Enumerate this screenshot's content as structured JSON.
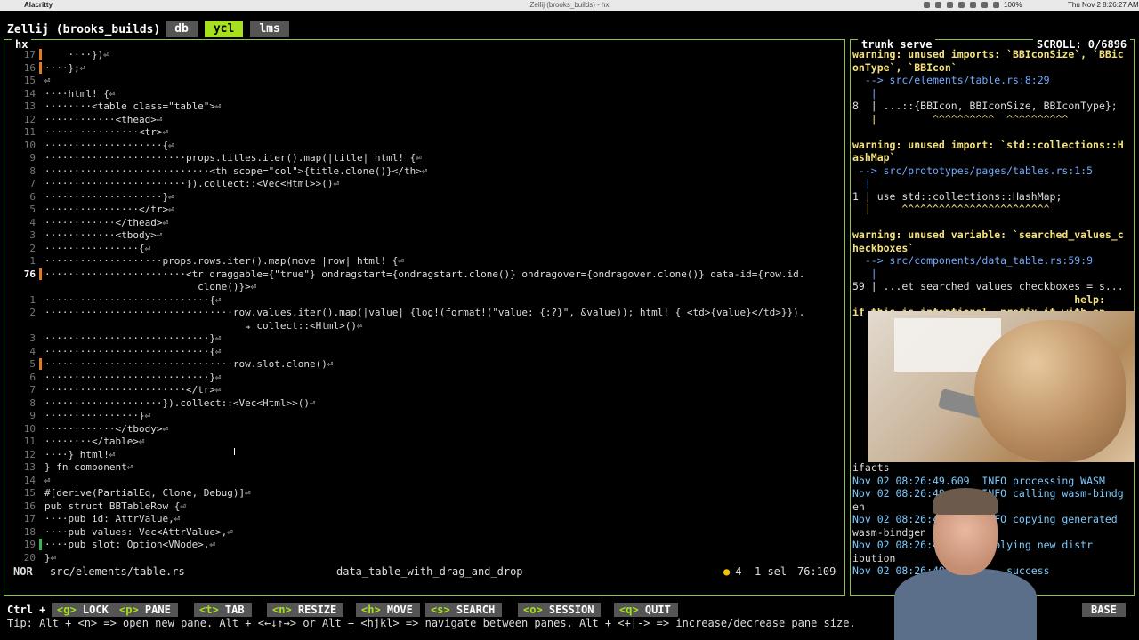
{
  "menubar": {
    "app": "Alacritty",
    "window_title": "Zellij (brooks_builds) - hx",
    "battery": "100%",
    "clock": "Thu Nov 2  8:26:27 AM"
  },
  "zellij": {
    "session": "Zellij (brooks_builds)",
    "tabs": [
      {
        "label": "db",
        "active": false
      },
      {
        "label": "ycl",
        "active": true
      },
      {
        "label": "lms",
        "active": false
      }
    ]
  },
  "left_pane": {
    "title": "hx"
  },
  "editor": {
    "lines": [
      {
        "n": "17",
        "code": "    ····})⏎"
      },
      {
        "n": "16",
        "code": "····};⏎"
      },
      {
        "n": "15",
        "code": "⏎"
      },
      {
        "n": "14",
        "code": "····html! {⏎"
      },
      {
        "n": "13",
        "code": "········<table class=\"table\">⏎"
      },
      {
        "n": "12",
        "code": "············<thead>⏎"
      },
      {
        "n": "11",
        "code": "················<tr>⏎"
      },
      {
        "n": "10",
        "code": "····················{⏎"
      },
      {
        "n": "9",
        "code": "························props.titles.iter().map(|title| html! {⏎"
      },
      {
        "n": "8",
        "code": "····························<th scope=\"col\">{title.clone()}</th>⏎"
      },
      {
        "n": "7",
        "code": "························}).collect::<Vec<Html>>()⏎"
      },
      {
        "n": "6",
        "code": "····················}⏎"
      },
      {
        "n": "5",
        "code": "················</tr>⏎"
      },
      {
        "n": "4",
        "code": "············</thead>⏎"
      },
      {
        "n": "3",
        "code": "············<tbody>⏎"
      },
      {
        "n": "2",
        "code": "················{⏎"
      },
      {
        "n": "1",
        "code": "····················props.rows.iter().map(move |row| html! {⏎"
      },
      {
        "n": "76",
        "code": "························<tr draggable={\"true\"} ondragstart={ondragstart.clone()} ondragover={ondragover.clone()} data-id={row.id.",
        "cur": true
      },
      {
        "n": "",
        "code": "                          clone()}>⏎"
      },
      {
        "n": "1",
        "code": "····························{⏎"
      },
      {
        "n": "2",
        "code": "································row.values.iter().map(|value| {log!(format!(\"value: {:?}\", &value)); html! { <td>{value}</td>}})."
      },
      {
        "n": "",
        "code": "                                  ↳ collect::<Html>()⏎"
      },
      {
        "n": "3",
        "code": "····························}⏎"
      },
      {
        "n": "4",
        "code": "····························{⏎"
      },
      {
        "n": "5",
        "code": "································row.slot.clone()⏎"
      },
      {
        "n": "6",
        "code": "····························}⏎"
      },
      {
        "n": "7",
        "code": "························</tr>⏎"
      },
      {
        "n": "8",
        "code": "····················}).collect::<Vec<Html>>()⏎"
      },
      {
        "n": "9",
        "code": "················}⏎"
      },
      {
        "n": "10",
        "code": "············</tbody>⏎"
      },
      {
        "n": "11",
        "code": "········</table>⏎"
      },
      {
        "n": "12",
        "code": "····} html!⏎"
      },
      {
        "n": "13",
        "code": "} fn component⏎"
      },
      {
        "n": "14",
        "code": "⏎"
      },
      {
        "n": "15",
        "code": "#[derive(PartialEq, Clone, Debug)]⏎"
      },
      {
        "n": "16",
        "code": "pub struct BBTableRow {⏎"
      },
      {
        "n": "17",
        "code": "····pub id: AttrValue,⏎"
      },
      {
        "n": "18",
        "code": "····pub values: Vec<AttrValue>,⏎"
      },
      {
        "n": "19",
        "code": "····pub slot: Option<VNode>,⏎"
      },
      {
        "n": "20",
        "code": "}⏎"
      }
    ],
    "status": {
      "mode": "NOR",
      "file": "src/elements/table.rs",
      "branch": "data_table_with_drag_and_drop",
      "diagnostics": "4",
      "selections": "1 sel",
      "position": "76:109"
    }
  },
  "right_pane": {
    "title": "trunk serve",
    "scroll": "SCROLL:  0/6896",
    "lines": [
      {
        "t": "warning: unused imports: `BBIconSize`, `BBic",
        "c": "warn"
      },
      {
        "t": "onType`, `BBIcon`",
        "c": "warn"
      },
      {
        "t": "  --> src/elements/table.rs:8:29",
        "c": "arrow"
      },
      {
        "t": "   |",
        "c": "arrow"
      },
      {
        "t": "8  | ...::{BBIcon, BBIconSize, BBIconType};",
        "c": ""
      },
      {
        "t": "   |         ^^^^^^^^^^  ^^^^^^^^^^",
        "c": "caret"
      },
      {
        "t": "",
        "c": ""
      },
      {
        "t": "warning: unused import: `std::collections::H",
        "c": "warn"
      },
      {
        "t": "ashMap`",
        "c": "warn"
      },
      {
        "t": " --> src/prototypes/pages/tables.rs:1:5",
        "c": "arrow"
      },
      {
        "t": "  |",
        "c": "arrow"
      },
      {
        "t": "1 | use std::collections::HashMap;",
        "c": ""
      },
      {
        "t": "  |     ^^^^^^^^^^^^^^^^^^^^^^^^",
        "c": "caret"
      },
      {
        "t": "",
        "c": ""
      },
      {
        "t": "warning: unused variable: `searched_values_c",
        "c": "warn"
      },
      {
        "t": "heckboxes`",
        "c": "warn"
      },
      {
        "t": "  --> src/components/data_table.rs:59:9",
        "c": "arrow"
      },
      {
        "t": "   |",
        "c": "arrow"
      },
      {
        "t": "59 | ...et searched_values_checkboxes = s...",
        "c": ""
      },
      {
        "t": "                                    help:",
        "c": "warn"
      },
      {
        "t": "if this is intentional, prefix it with an",
        "c": "warn"
      }
    ],
    "log": [
      {
        "t": "ifacts",
        "c": ""
      },
      {
        "t": "Nov 02 08:26:49.609  INFO processing WASM",
        "c": "info"
      },
      {
        "t": "Nov 02 08:26:49.6..  INFO calling wasm-bindg",
        "c": "info"
      },
      {
        "t": "en",
        "c": ""
      },
      {
        "t": "Nov 02 08:26:49....  INFO copying generated",
        "c": "info"
      },
      {
        "t": "wasm-bindgen a...",
        "c": ""
      },
      {
        "t": "Nov 02 08:26:4...   ...plying new distr",
        "c": "info"
      },
      {
        "t": "ibution",
        "c": ""
      },
      {
        "t": "Nov 02 08:26:49...       success",
        "c": "info"
      }
    ]
  },
  "hintbar": {
    "ctrl": "Ctrl +",
    "keys": [
      {
        "k": "<g>",
        "label": "LOCK"
      },
      {
        "k": "<p>",
        "label": "PANE"
      },
      {
        "k": "<t>",
        "label": "TAB"
      },
      {
        "k": "<n>",
        "label": "RESIZE"
      },
      {
        "k": "<h>",
        "label": "MOVE"
      },
      {
        "k": "<s>",
        "label": "SEARCH"
      },
      {
        "k": "<o>",
        "label": "SESSION"
      },
      {
        "k": "<q>",
        "label": "QUIT"
      }
    ],
    "mode": "BASE",
    "tip": "Tip: Alt + <n> => open new pane. Alt + <←↓↑→> or Alt + <hjkl> => navigate between panes. Alt + <+|-> => increase/decrease pane size."
  }
}
